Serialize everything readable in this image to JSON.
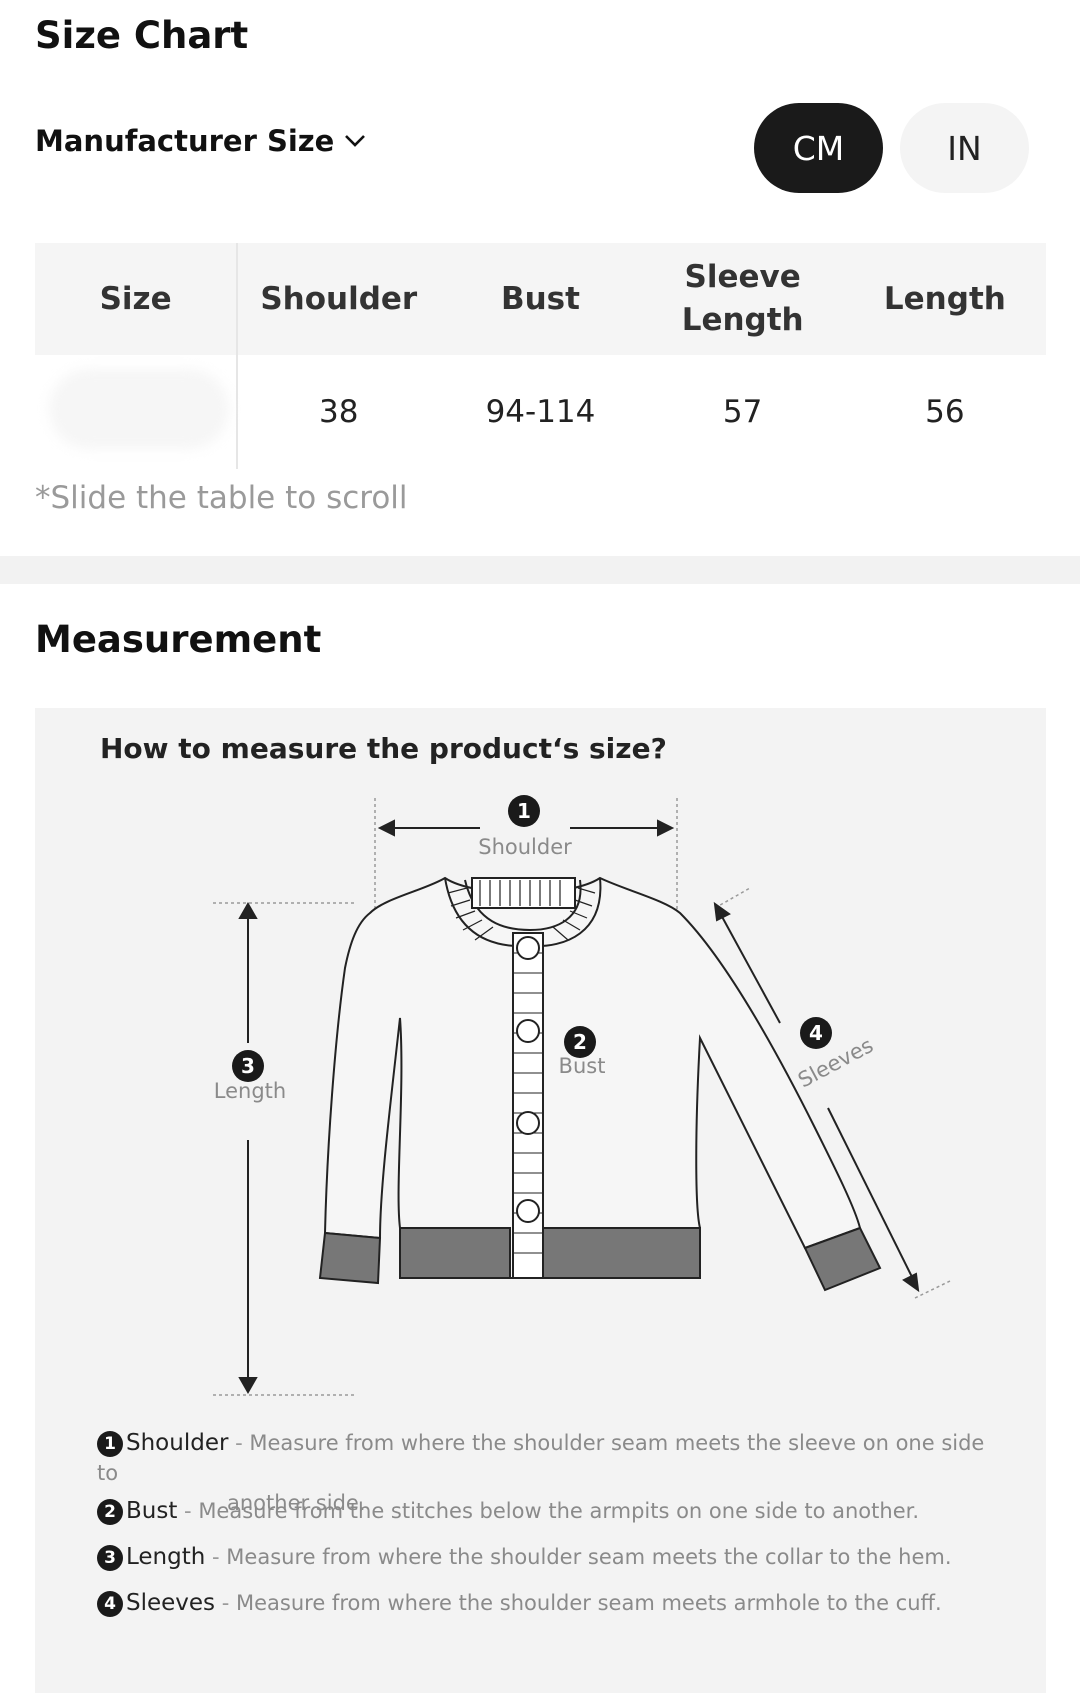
{
  "size_chart": {
    "title": "Size Chart",
    "manufacturer_label": "Manufacturer Size",
    "units": [
      "CM",
      "IN"
    ],
    "selected_unit": "CM",
    "columns": [
      "Size",
      "Shoulder",
      "Bust",
      "Sleeve Length",
      "Length"
    ],
    "rows": [
      {
        "size": "",
        "shoulder": "38",
        "bust": "94-114",
        "sleeve_length": "57",
        "length": "56"
      }
    ],
    "hint": "*Slide the table to scroll"
  },
  "measurement": {
    "title": "Measurement",
    "question": "How to measure the product‘s size?",
    "labels": {
      "shoulder": "Shoulder",
      "bust": "Bust",
      "length": "Length",
      "sleeves": "Sleeves"
    },
    "legend": [
      {
        "num": "1",
        "term": "Shoulder",
        "desc": "Measure from where the shoulder seam meets the sleeve on one side to",
        "desc_cont": "another side."
      },
      {
        "num": "2",
        "term": "Bust",
        "desc": "Measure from the stitches below the armpits on one side to another."
      },
      {
        "num": "3",
        "term": "Length",
        "desc": "Measure from where the shoulder seam meets the collar to the hem."
      },
      {
        "num": "4",
        "term": "Sleeves",
        "desc": "Measure from where the shoulder seam meets armhole to the cuff."
      }
    ]
  }
}
